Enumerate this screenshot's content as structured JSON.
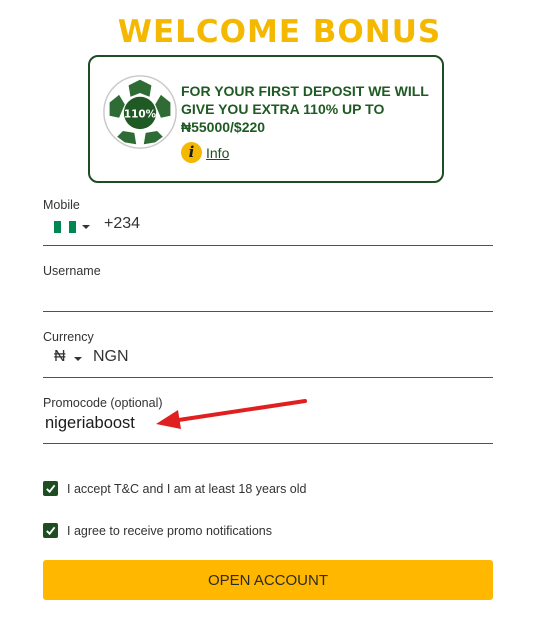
{
  "header": {
    "title": "WELCOME BONUS"
  },
  "bonus": {
    "ball_label": "110%",
    "text": "FOR YOUR FIRST DEPOSIT WE WILL GIVE YOU EXTRA 110% UP TO ₦55000/$220",
    "info_label": "Info"
  },
  "form": {
    "mobile": {
      "label": "Mobile",
      "prefix": "+234",
      "flag_colors": [
        "#008751",
        "#ffffff",
        "#008751"
      ]
    },
    "username": {
      "label": "Username",
      "value": ""
    },
    "currency": {
      "label": "Currency",
      "symbol": "₦",
      "value": "NGN"
    },
    "promocode": {
      "label": "Promocode (optional)",
      "value": "nigeriaboost"
    }
  },
  "checkboxes": [
    {
      "label": "I accept T&C and I am at least 18 years old",
      "checked": true
    },
    {
      "label": "I agree to receive promo notifications",
      "checked": true
    }
  ],
  "submit": {
    "label": "OPEN ACCOUNT"
  },
  "colors": {
    "accent": "#ffb700",
    "brand_green": "#1f4d22",
    "annotation_arrow": "#e02020"
  }
}
